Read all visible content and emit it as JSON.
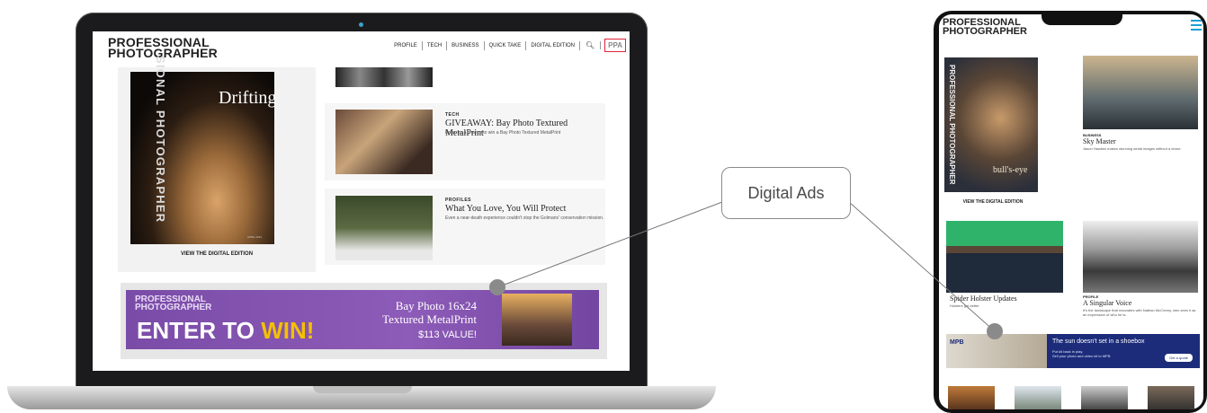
{
  "callout": {
    "label": "Digital Ads"
  },
  "desktop": {
    "logo": [
      "PROFESSIONAL",
      "PHOTOGRAPHER"
    ],
    "nav": [
      "PROFILE",
      "TECH",
      "BUSINESS",
      "QUICK TAKE",
      "DIGITAL EDITION"
    ],
    "nav_badge": "PPA",
    "cover": {
      "title": "Drifting",
      "spine": "SIONAL PHOTOGRAPHER",
      "date": "APRIL 2021",
      "cta": "VIEW THE DIGITAL EDITION"
    },
    "articles": [
      {
        "category": "TECH",
        "title": "GIVEAWAY: Bay Photo Textured MetalPrint",
        "desc": "Enter for a chance to win a Bay Photo Textured MetalPrint"
      },
      {
        "category": "PROFILES",
        "title": "What You Love, You Will Protect",
        "desc": "Even a near-death experience couldn't stop the Golmans' conservation mission."
      }
    ],
    "ad": {
      "logo": [
        "PROFESSIONAL",
        "PHOTOGRAPHER"
      ],
      "enter_prefix": "ENTER TO ",
      "enter_highlight": "WIN!",
      "offer": [
        "Bay Photo 16x24",
        "Textured MetalPrint"
      ],
      "value": "$113 VALUE!"
    }
  },
  "tablet": {
    "logo": [
      "PROFESSIONAL",
      "PHOTOGRAPHER"
    ],
    "cover": {
      "spine": "PROFESSIONAL PHOTOGRAPHER",
      "title": "bull's-eye",
      "cta": "VIEW THE DIGITAL EDITION"
    },
    "articles": [
      {
        "category": "BUSINESS",
        "title": "Sky Master",
        "desc": "Jason Hawkes makes stunning aerial images without a drone."
      },
      {
        "category": "",
        "title": "Spider Holster Updates",
        "desc": "Holsters get better"
      },
      {
        "category": "PROFILE",
        "title": "A Singular Voice",
        "desc": "It's the landscape that resonates with Nathan McCreery, who sees it as an expression of who he is."
      }
    ],
    "ad": {
      "logo": "MPB",
      "headline": "The sun doesn't set in a shoebox",
      "sub": [
        "Put kit back in play.",
        "Sell your photo and video kit to MPB"
      ],
      "button": "Get a quote"
    }
  }
}
